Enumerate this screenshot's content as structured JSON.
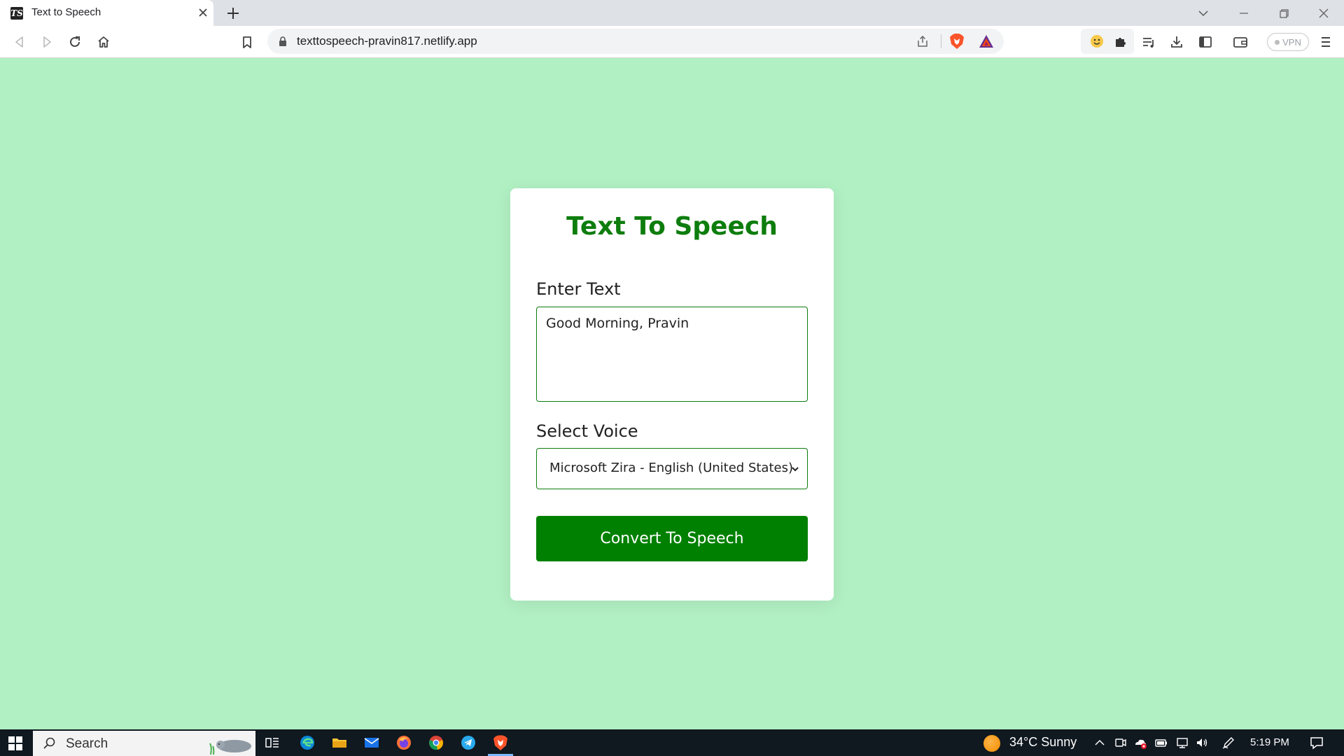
{
  "browser": {
    "tab_title": "Text to Speech",
    "tab_favicon_text": "TS",
    "url": "texttospeech-pravin817.netlify.app",
    "vpn_label": "VPN"
  },
  "page": {
    "title": "Text To Speech",
    "text_label": "Enter Text",
    "text_value": "Good Morning, Pravin",
    "voice_label": "Select Voice",
    "voice_selected": "Microsoft Zira - English (United States)",
    "convert_button": "Convert To Speech"
  },
  "taskbar": {
    "search_text": "Search",
    "weather": "34°C  Sunny",
    "time": "5:19 PM"
  },
  "colors": {
    "background": "#b1f0c3",
    "accent": "#0d7d0d",
    "button": "#008000"
  }
}
